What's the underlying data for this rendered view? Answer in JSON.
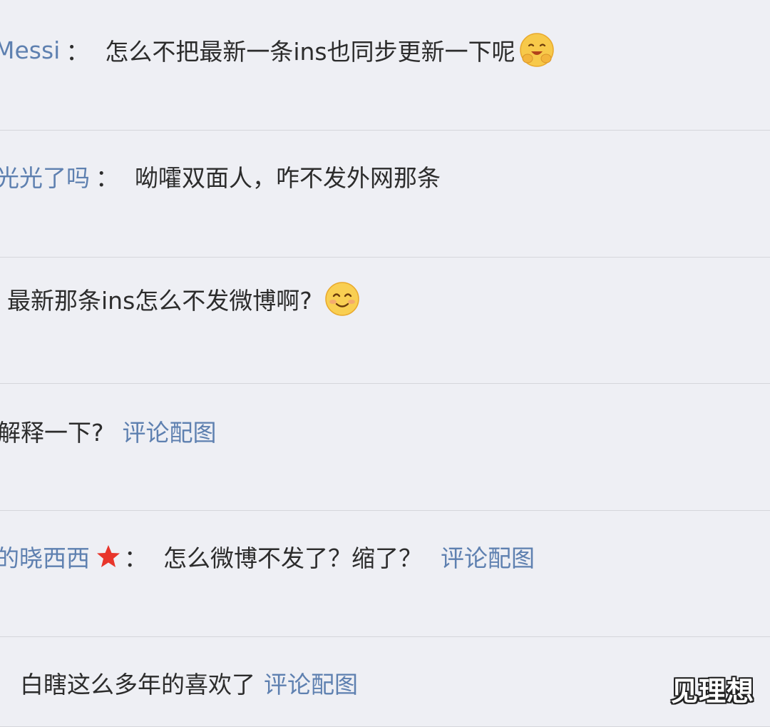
{
  "comments": [
    {
      "username": "Messi",
      "separator": "：",
      "text": "怎么不把最新一条ins也同步更新一下呢",
      "emoji": "hug-emoji"
    },
    {
      "username": "光光了吗",
      "separator": "：",
      "text": "呦嚯双面人，咋不发外网那条"
    },
    {
      "text": "最新那条ins怎么不发微博啊?",
      "emoji": "smile-emoji"
    },
    {
      "text": "解释一下?",
      "link": "评论配图"
    },
    {
      "username": "的晓西西",
      "badge": "star-icon",
      "separator": "：",
      "text": "怎么微博不发了？缩了？",
      "link": "评论配图"
    },
    {
      "text": "白瞎这么多年的喜欢了",
      "link": "评论配图"
    }
  ],
  "watermark": "见理想",
  "colors": {
    "background": "#eeeff4",
    "divider": "#d5d6db",
    "username": "#5e80b0",
    "text": "#2c2c2c",
    "star": "#e8352b"
  }
}
